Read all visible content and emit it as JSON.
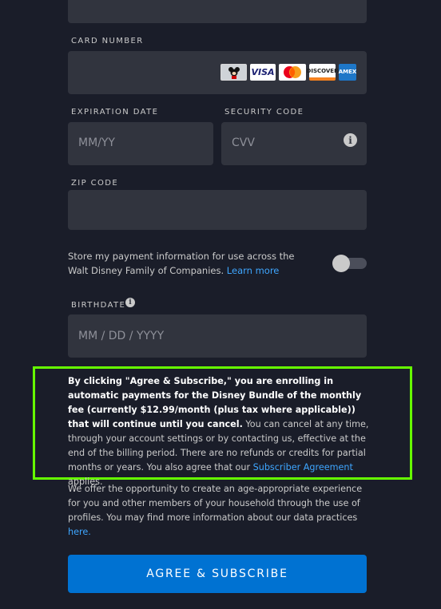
{
  "card_number": {
    "label": "CARD NUMBER",
    "card_brands": [
      "Disney",
      "VISA",
      "Mastercard",
      "DISCOVER",
      "AMEX"
    ]
  },
  "expiration": {
    "label": "EXPIRATION DATE",
    "placeholder": "MM/YY"
  },
  "security": {
    "label": "SECURITY CODE",
    "placeholder": "CVV",
    "icon": "info-icon"
  },
  "zip": {
    "label": "ZIP CODE"
  },
  "store_info": {
    "text": "Store my payment information for use across the Walt Disney Family of Companies.",
    "learn_more": "Learn more",
    "toggle_on": false
  },
  "birthdate": {
    "label": "BIRTHDATE",
    "placeholder": "MM / DD / YYYY",
    "icon": "info-icon"
  },
  "agreement": {
    "bold_text": "By clicking \"Agree & Subscribe,\" you are enrolling in automatic payments for the Disney Bundle of the monthly fee (currently $12.99/month (plus tax where applicable)) that will continue until you cancel.",
    "regular_text": "You can cancel at any time, through your account settings or by contacting us, effective at the end of the billing period. There are no refunds or credits for partial months or years. You also agree that our",
    "link_text": "Subscriber Agreement",
    "end_text": "applies."
  },
  "privacy": {
    "text": "We offer the opportunity to create an age-appropriate experience for you and other members of your household through the use of profiles. You may find more information about our data practices",
    "link_text": "here."
  },
  "submit_label": "AGREE & SUBSCRIBE",
  "colors": {
    "background": "#1a1d29",
    "field": "#31343e",
    "button": "#0072d2",
    "link": "#3ea6ff",
    "highlight": "#66ff00"
  }
}
